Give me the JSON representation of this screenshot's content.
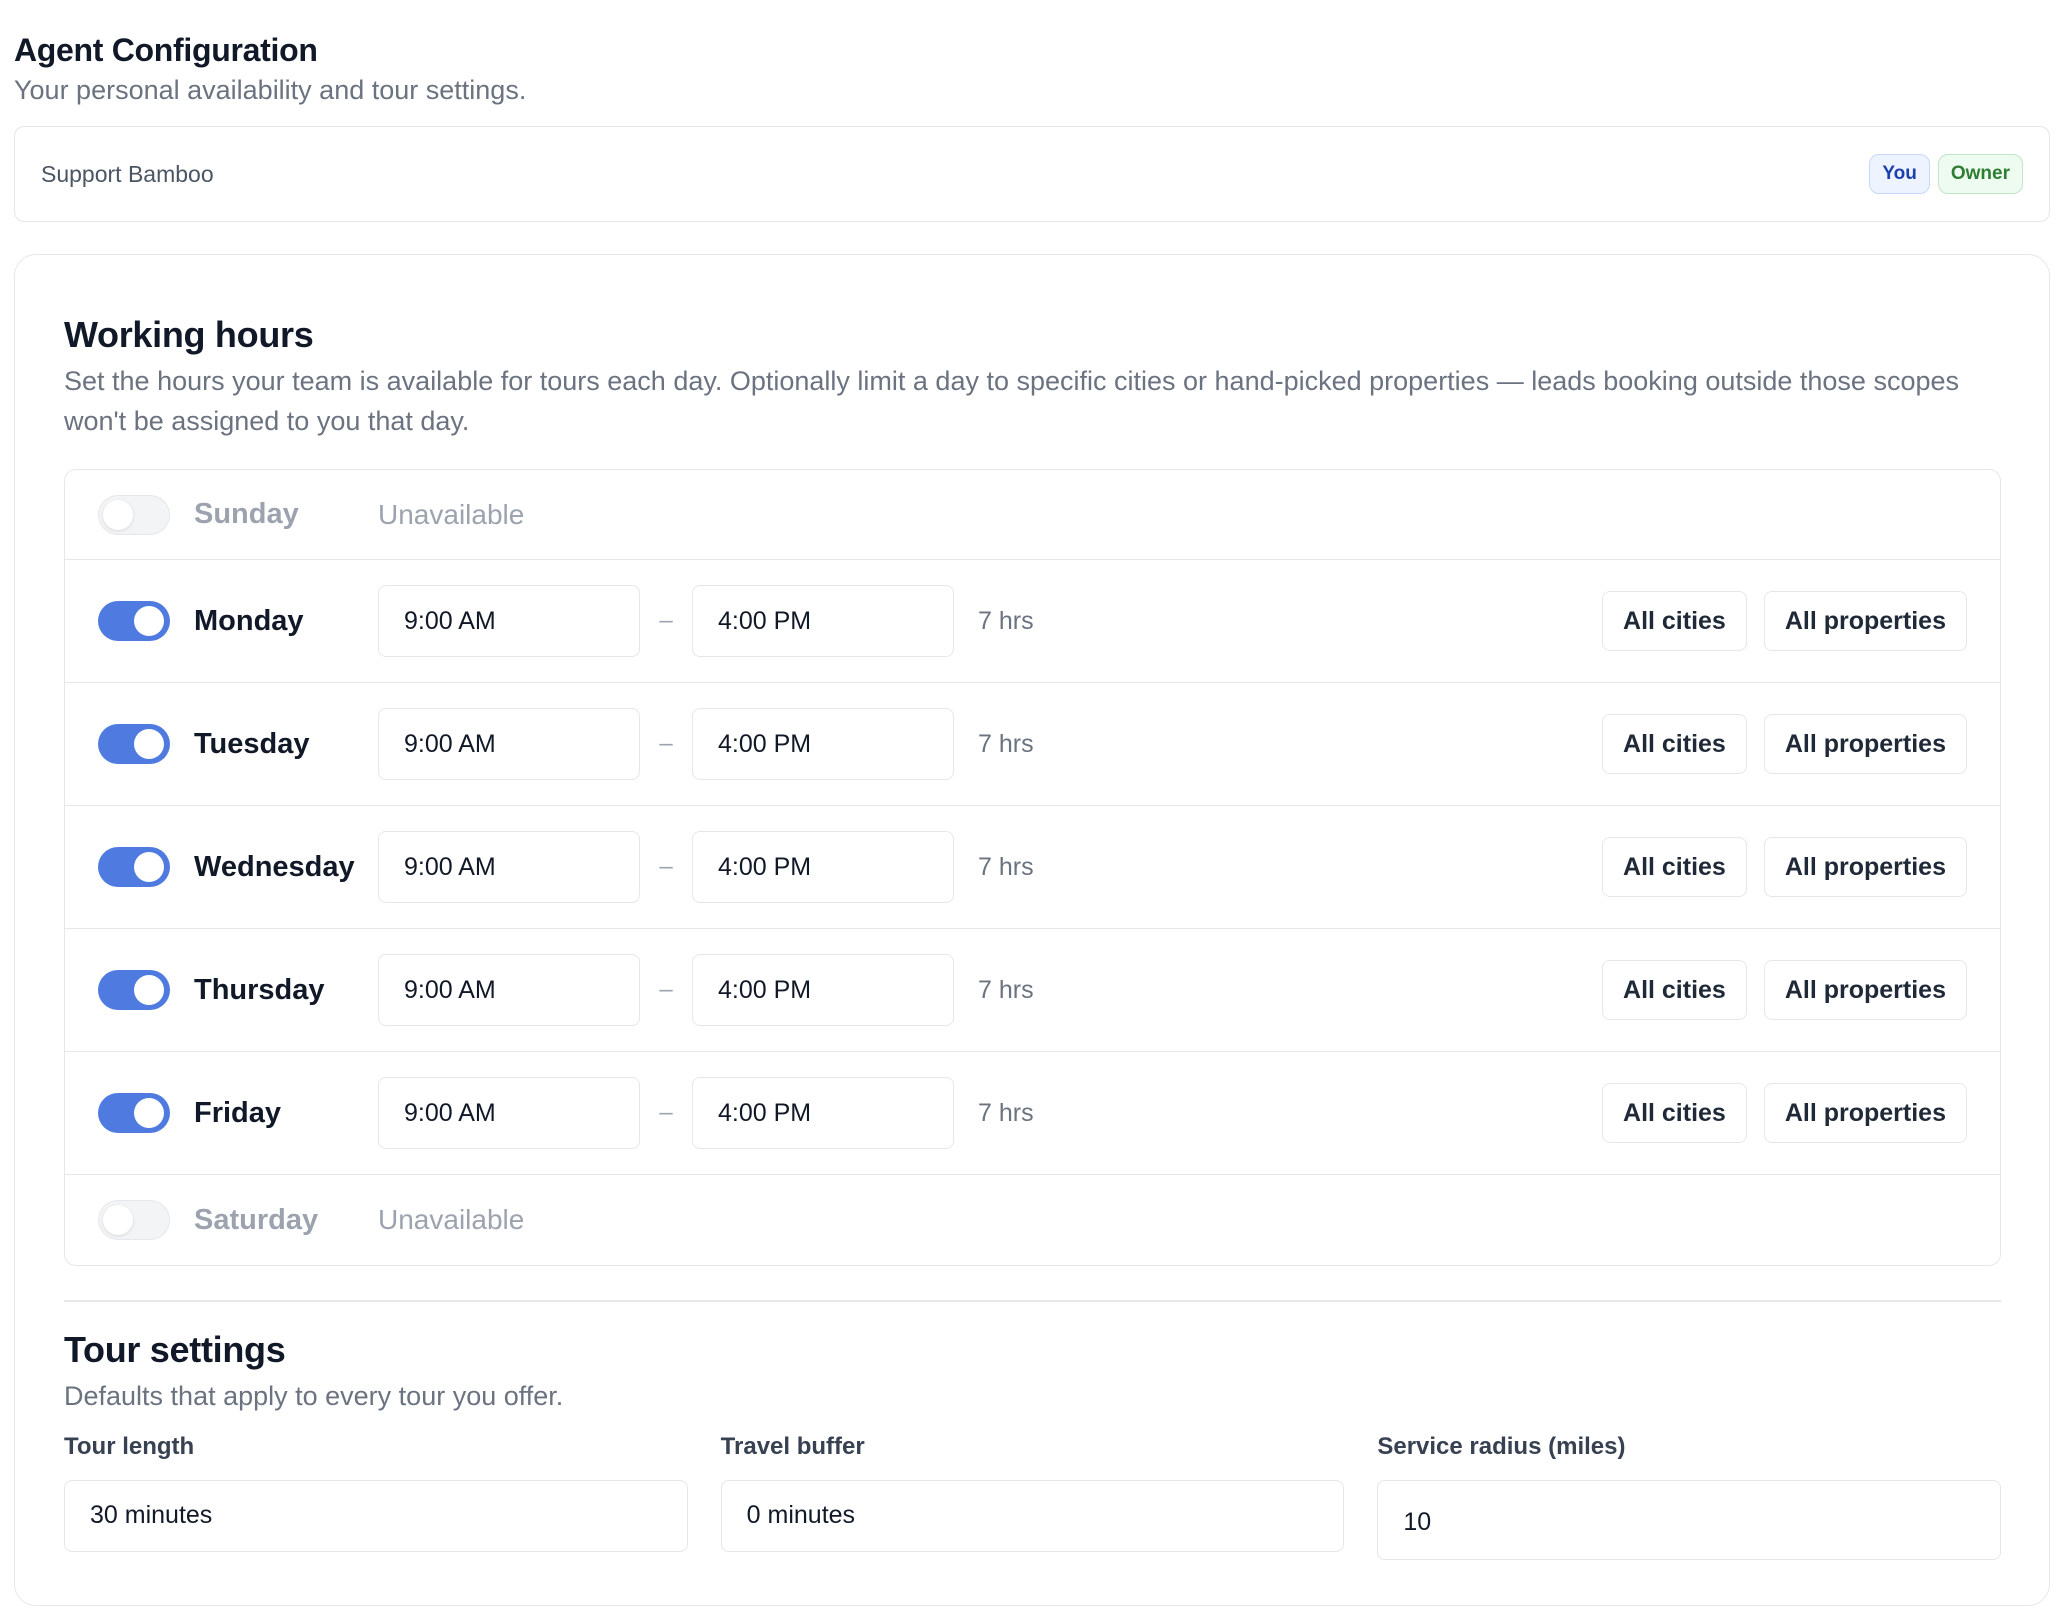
{
  "header": {
    "title": "Agent Configuration",
    "subtitle": "Your personal availability and tour settings."
  },
  "agent": {
    "name": "Support Bamboo",
    "badges": {
      "you": "You",
      "owner": "Owner"
    }
  },
  "working_hours": {
    "title": "Working hours",
    "description": "Set the hours your team is available for tours each day. Optionally limit a day to specific cities or hand-picked properties — leads booking outside those scopes won't be assigned to you that day.",
    "unavailable_label": "Unavailable",
    "dash": "–",
    "days": [
      {
        "name": "Sunday",
        "enabled": false,
        "status": "Unavailable"
      },
      {
        "name": "Monday",
        "enabled": true,
        "start": "9:00 AM",
        "end": "4:00 PM",
        "hours": "7 hrs",
        "cities": "All cities",
        "properties": "All properties"
      },
      {
        "name": "Tuesday",
        "enabled": true,
        "start": "9:00 AM",
        "end": "4:00 PM",
        "hours": "7 hrs",
        "cities": "All cities",
        "properties": "All properties"
      },
      {
        "name": "Wednesday",
        "enabled": true,
        "start": "9:00 AM",
        "end": "4:00 PM",
        "hours": "7 hrs",
        "cities": "All cities",
        "properties": "All properties"
      },
      {
        "name": "Thursday",
        "enabled": true,
        "start": "9:00 AM",
        "end": "4:00 PM",
        "hours": "7 hrs",
        "cities": "All cities",
        "properties": "All properties"
      },
      {
        "name": "Friday",
        "enabled": true,
        "start": "9:00 AM",
        "end": "4:00 PM",
        "hours": "7 hrs",
        "cities": "All cities",
        "properties": "All properties"
      },
      {
        "name": "Saturday",
        "enabled": false,
        "status": "Unavailable"
      }
    ]
  },
  "tour_settings": {
    "title": "Tour settings",
    "description": "Defaults that apply to every tour you offer.",
    "tour_length": {
      "label": "Tour length",
      "value": "30 minutes"
    },
    "travel_buffer": {
      "label": "Travel buffer",
      "value": "0 minutes"
    },
    "service_radius": {
      "label": "Service radius (miles)",
      "value": "10"
    }
  },
  "colors": {
    "accent": "#4f7be0",
    "you_badge": "#1e40af",
    "owner_badge": "#2f7d32"
  }
}
